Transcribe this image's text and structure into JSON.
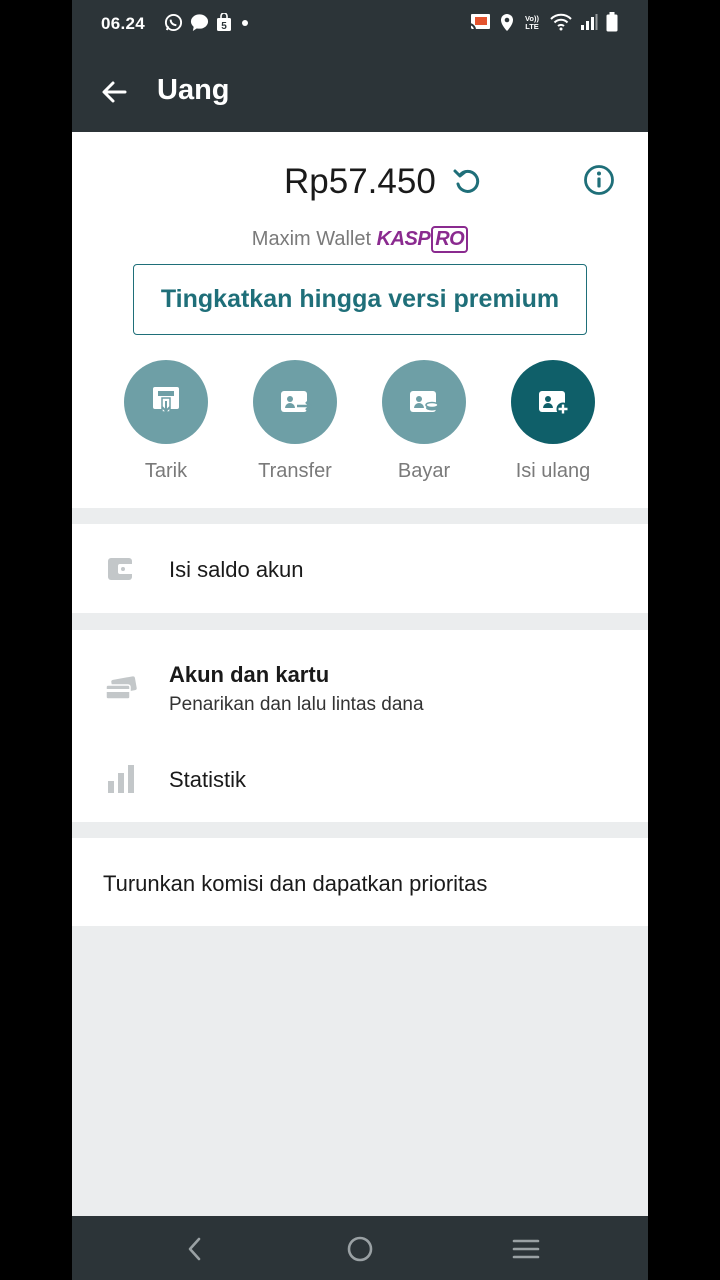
{
  "status_bar": {
    "time": "06.24",
    "left_icons": [
      "whatsapp-icon",
      "chat-bubble-icon",
      "shopping-bag-icon",
      "dot-icon"
    ],
    "right_icons": [
      "cast-icon",
      "location-icon",
      "volte-icon",
      "wifi-icon",
      "signal-icon",
      "battery-icon"
    ],
    "volte_label": "Vo)) LTE",
    "bag_label": "5"
  },
  "appbar": {
    "title": "Uang"
  },
  "wallet": {
    "balance": "Rp57.450",
    "wallet_prefix": "Maxim Wallet",
    "brand_main": "KASP",
    "brand_box": "RO",
    "premium_button": "Tingkatkan hingga versi premium"
  },
  "actions": [
    {
      "label": "Tarik",
      "icon": "atm-withdraw-icon",
      "active": false
    },
    {
      "label": "Transfer",
      "icon": "wallet-transfer-icon",
      "active": false
    },
    {
      "label": "Bayar",
      "icon": "wallet-pay-icon",
      "active": false
    },
    {
      "label": "Isi ulang",
      "icon": "wallet-topup-icon",
      "active": true
    }
  ],
  "menu": {
    "topup_account": "Isi saldo akun",
    "accounts_title": "Akun dan kartu",
    "accounts_sub": "Penarikan dan lalu lintas dana",
    "statistics": "Statistik",
    "commission": "Turunkan komisi dan dapatkan prioritas"
  },
  "colors": {
    "bar": "#2c3438",
    "accent": "#1f6f79",
    "action_inactive": "#6e9fa6",
    "action_active": "#0f5f69",
    "brand": "#8a2a8f",
    "background": "#ebedee"
  },
  "nav": [
    "back-nav-icon",
    "home-nav-icon",
    "recents-nav-icon"
  ]
}
